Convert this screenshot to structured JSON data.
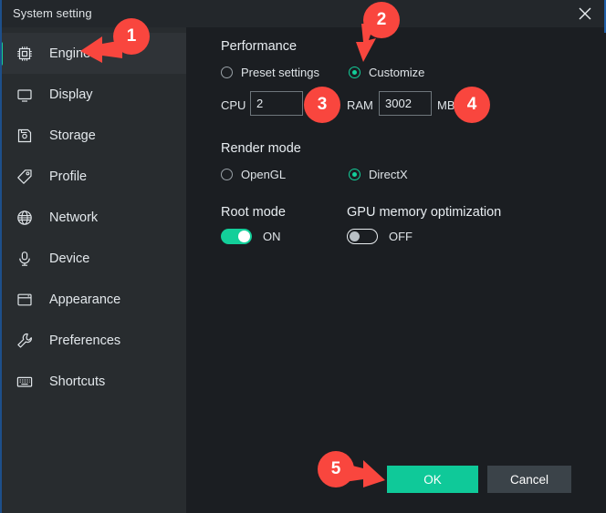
{
  "window": {
    "title": "System setting",
    "close_icon": "close-icon"
  },
  "sidebar": {
    "items": [
      {
        "label": "Engine",
        "icon": "cpu-chip-icon",
        "active": true
      },
      {
        "label": "Display",
        "icon": "monitor-icon",
        "active": false
      },
      {
        "label": "Storage",
        "icon": "floppy-disk-icon",
        "active": false
      },
      {
        "label": "Profile",
        "icon": "tag-icon",
        "active": false
      },
      {
        "label": "Network",
        "icon": "globe-icon",
        "active": false
      },
      {
        "label": "Device",
        "icon": "device-icon",
        "active": false
      },
      {
        "label": "Appearance",
        "icon": "window-icon",
        "active": false
      },
      {
        "label": "Preferences",
        "icon": "wrench-icon",
        "active": false
      },
      {
        "label": "Shortcuts",
        "icon": "keyboard-icon",
        "active": false
      }
    ]
  },
  "main": {
    "performance": {
      "title": "Performance",
      "preset_label": "Preset settings",
      "preset_selected": false,
      "customize_label": "Customize",
      "customize_selected": true,
      "cpu_label": "CPU",
      "cpu_value": "2",
      "ram_label": "RAM",
      "ram_value": "3002",
      "ram_unit": "MB"
    },
    "render_mode": {
      "title": "Render mode",
      "opengl_label": "OpenGL",
      "opengl_selected": false,
      "directx_label": "DirectX",
      "directx_selected": true
    },
    "root_mode": {
      "title": "Root mode",
      "state": "ON"
    },
    "gpu_memory": {
      "title": "GPU memory optimization",
      "state": "OFF"
    }
  },
  "footer": {
    "ok_label": "OK",
    "cancel_label": "Cancel"
  },
  "annotations": {
    "markers": [
      {
        "number": "1",
        "arrow": "left"
      },
      {
        "number": "2",
        "arrow": "down"
      },
      {
        "number": "3",
        "arrow": "none"
      },
      {
        "number": "4",
        "arrow": "none"
      },
      {
        "number": "5",
        "arrow": "right"
      }
    ]
  },
  "colors": {
    "accent": "#13cf9a",
    "marker": "#f9463e",
    "sidebar_bg": "#282c2f",
    "panel_bg": "#1b1e22",
    "titlebar_bg": "#23272b"
  }
}
